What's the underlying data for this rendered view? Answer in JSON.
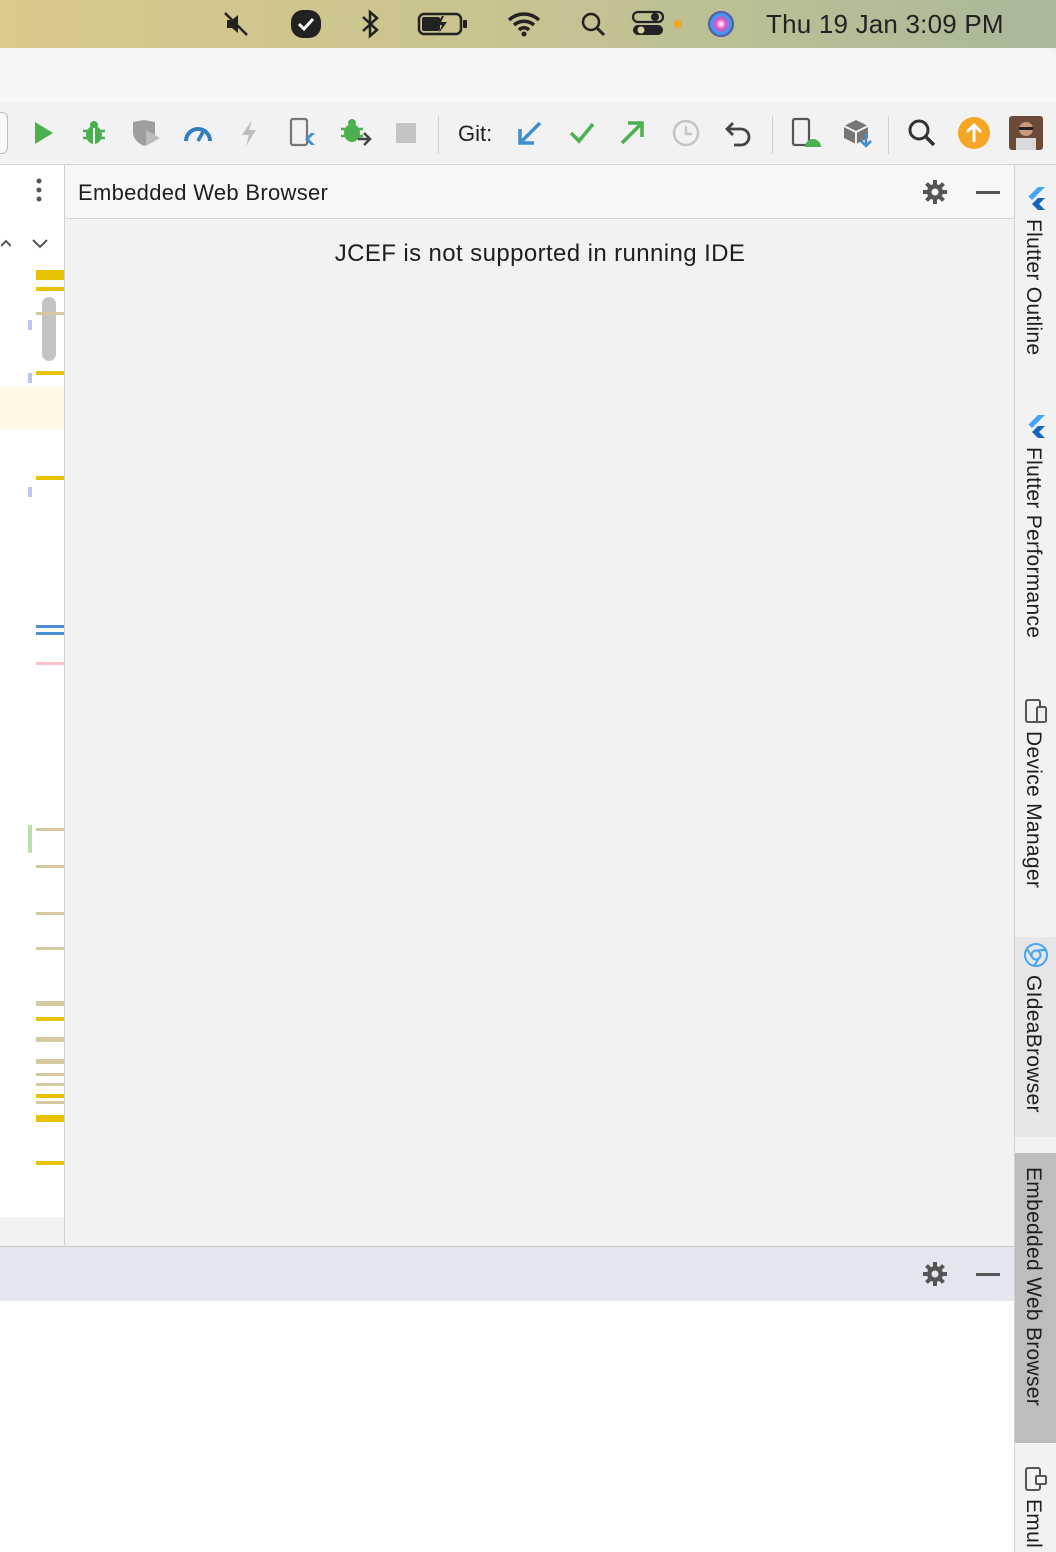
{
  "menubar": {
    "clock_text": "Thu 19 Jan  3:09 PM",
    "icons": [
      "mute-icon",
      "todo-icon",
      "bluetooth-icon",
      "battery-charging-icon",
      "wifi-icon",
      "spotlight-search-icon",
      "control-center-icon",
      "siri-icon"
    ]
  },
  "toolbar": {
    "git_label": "Git:",
    "icons": [
      "run-icon",
      "debug-icon",
      "coverage-icon",
      "profile-icon",
      "hot-reload-icon",
      "flutter-attach-icon",
      "attach-debugger-icon",
      "stop-icon",
      "git-update-icon",
      "git-commit-icon",
      "git-push-icon",
      "git-history-icon",
      "git-rollback-icon",
      "device-manager-icon",
      "sdk-manager-icon",
      "search-everywhere-icon",
      "update-available-icon",
      "user-avatar"
    ]
  },
  "browser_panel": {
    "title": "Embedded Web Browser",
    "message": "JCEF is not supported in running IDE"
  },
  "right_tools": [
    {
      "label": "Flutter Outline",
      "icon": "flutter-icon"
    },
    {
      "label": "Flutter Performance",
      "icon": "flutter-icon"
    },
    {
      "label": "Device Manager",
      "icon": "device-manager-icon"
    },
    {
      "label": "GIdeaBrowser",
      "icon": "chrome-icon"
    },
    {
      "label": "Embedded Web Browser",
      "icon": ""
    },
    {
      "label": "Emul",
      "icon": "emulator-icon"
    }
  ],
  "colors": {
    "accent_blue": "#3d8fd1",
    "run_green": "#4caf50",
    "update_orange": "#f5a623",
    "marker_yellow": "#e8c100",
    "active_tool_bg": "#bdbdbd"
  }
}
